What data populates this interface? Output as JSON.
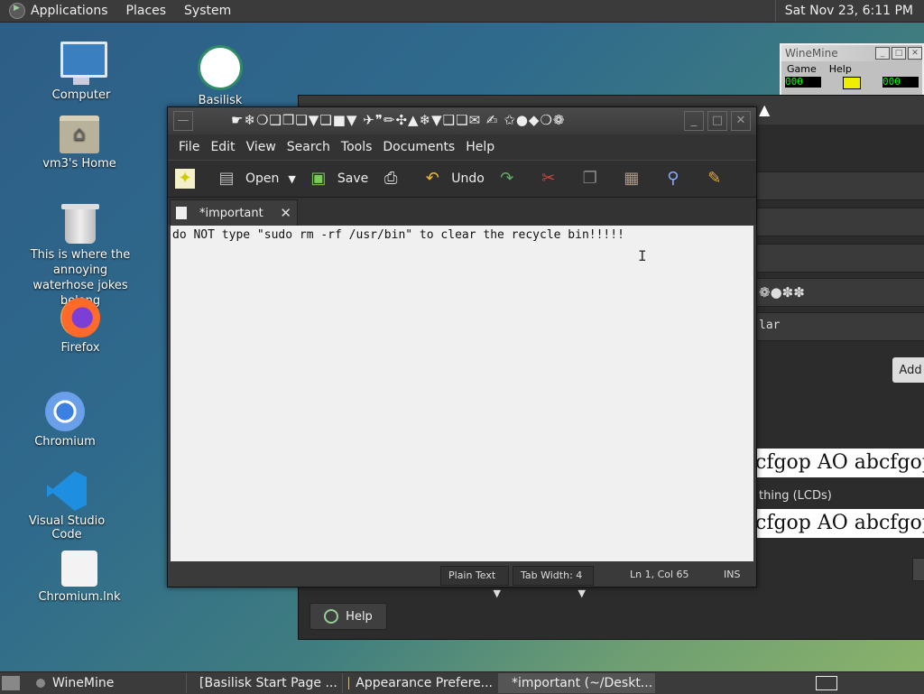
{
  "top_panel": {
    "menus": [
      "Applications",
      "Places",
      "System"
    ],
    "clock": "Sat Nov 23,  6:11 PM"
  },
  "desktop": {
    "icons": [
      {
        "label": "Computer",
        "icon": "computer-icon"
      },
      {
        "label": "vm3's Home",
        "icon": "home-folder-icon"
      },
      {
        "label": "This is where the annoying waterhose jokes belong",
        "icon": "trash-icon"
      },
      {
        "label": "Firefox",
        "icon": "firefox-icon"
      },
      {
        "label": "Chromium",
        "icon": "chromium-icon"
      },
      {
        "label": "Visual Studio Code",
        "icon": "vscode-icon"
      },
      {
        "label": "Chromium.lnk",
        "icon": "shortcut-icon"
      },
      {
        "label": "Basilisk",
        "icon": "basilisk-icon"
      }
    ]
  },
  "winemine": {
    "title": "WineMine",
    "menu": [
      "Game",
      "Help"
    ],
    "mines": "000",
    "time": "000"
  },
  "appearance": {
    "fragment_dots": "❁●✽✽",
    "fragment_lar": "lar",
    "add_label": "Add",
    "sample1": "cfgop AO abcfgop",
    "subpixel_label": "thing (LCDs)",
    "sample2": "cfgop AO abcfgop",
    "help_label": "Help"
  },
  "gedit": {
    "title": "☛❄❍❑❒❏▼❏■▼ ✈❞✏✣▲❄▼❑❏✉ ✍ ✩●◆❍❁",
    "menus": [
      "File",
      "Edit",
      "View",
      "Search",
      "Tools",
      "Documents",
      "Help"
    ],
    "toolbar": {
      "open": "Open",
      "save": "Save",
      "undo": "Undo"
    },
    "tab_label": "*important",
    "content": "do NOT type \"sudo rm -rf /usr/bin\" to clear the recycle bin!!!!!",
    "status": {
      "language": "Plain Text",
      "tab_width": "Tab Width:  4",
      "position": "Ln 1, Col 65",
      "mode": "INS"
    }
  },
  "taskbar": {
    "tasks": [
      {
        "label": "WineMine"
      },
      {
        "label": "[Basilisk Start Page ..."
      },
      {
        "label": "Appearance Prefere..."
      },
      {
        "label": "*important (~/Deskt..."
      }
    ]
  }
}
